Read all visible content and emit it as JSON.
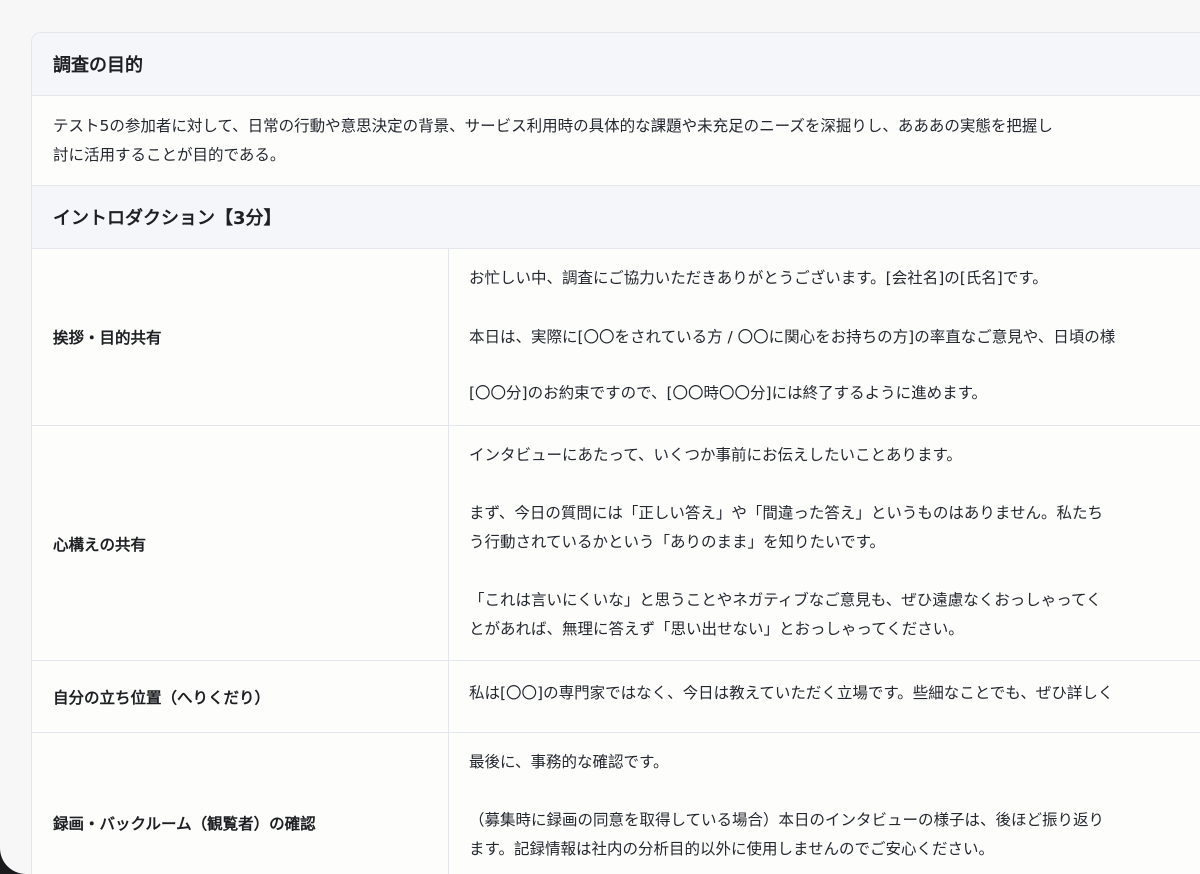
{
  "purpose": {
    "heading": "調査の目的",
    "line1": "テスト5の参加者に対して、日常の行動や意思決定の背景、サービス利用時の具体的な課題や未充足のニーズを深掘りし、あああの実態を把握し",
    "line2": "討に活用することが目的である。"
  },
  "intro": {
    "heading": "イントロダクション【3分】",
    "rows": [
      {
        "label": "挨拶・目的共有",
        "lines": [
          "お忙しい中、調査にご協力いただきありがとうございます。[会社名]の[氏名]です。",
          "本日は、実際に[〇〇をされている方 / 〇〇に関心をお持ちの方]の率直なご意見や、日頃の様",
          "[〇〇分]のお約束ですので、[〇〇時〇〇分]には終了するように進めます。"
        ]
      },
      {
        "label": "心構えの共有",
        "lines": [
          "インタビューにあたって、いくつか事前にお伝えしたいことあります。",
          "まず、今日の質問には「正しい答え」や「間違った答え」というものはありません。私たち",
          "う行動されているかという「ありのまま」を知りたいです。",
          "「これは言いにくいな」と思うことやネガティブなご意見も、ぜひ遠慮なくおっしゃってく",
          "とがあれば、無理に答えず「思い出せない」とおっしゃってください。"
        ]
      },
      {
        "label": "自分の立ち位置（へりくだり）",
        "lines": [
          "私は[〇〇]の専門家ではなく、今日は教えていただく立場です。些細なことでも、ぜひ詳しく"
        ]
      },
      {
        "label": "録画・バックルーム（観覧者）の確認",
        "lines": [
          "最後に、事務的な確認です。",
          "（募集時に録画の同意を取得している場合）本日のインタビューの様子は、後ほど振り返り",
          "ます。記録情報は社内の分析目的以外に使用しませんのでご安心ください。"
        ]
      }
    ]
  }
}
